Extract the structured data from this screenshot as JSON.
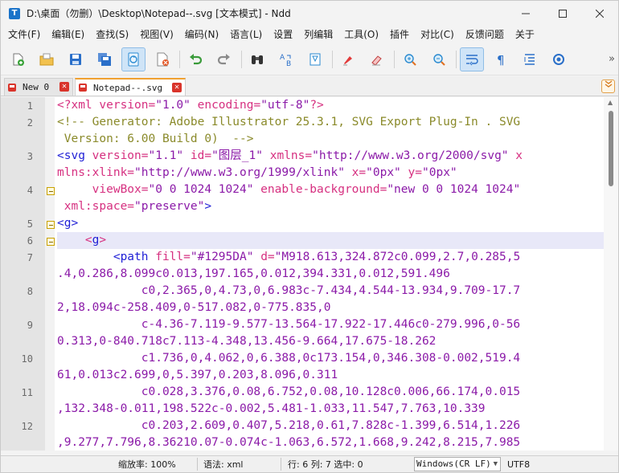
{
  "window": {
    "title": "D:\\桌面（勿删）\\Desktop\\Notepad--.svg [文本模式] - Ndd",
    "app_icon_letter": "T"
  },
  "menu": [
    "文件(F)",
    "编辑(E)",
    "查找(S)",
    "视图(V)",
    "编码(N)",
    "语言(L)",
    "设置",
    "列编辑",
    "工具(O)",
    "插件",
    "对比(C)",
    "反馈问题",
    "关于"
  ],
  "toolbar": {
    "buttons": [
      "new-file-icon",
      "open-folder-icon",
      "save-icon",
      "save-all-icon",
      "file-sync-icon",
      "close-file-icon",
      "undo-icon",
      "redo-icon",
      "find-binoculars-icon",
      "replace-icon",
      "bookmark-icon",
      "highlight-marker-icon",
      "eraser-icon",
      "zoom-in-icon",
      "zoom-out-icon",
      "word-wrap-icon",
      "show-symbols-icon",
      "indent-guide-icon",
      "settings-circle-icon"
    ],
    "more_label": "»"
  },
  "tabs": [
    {
      "label": "New 0",
      "active": false
    },
    {
      "label": "Notepad--.svg",
      "active": true
    }
  ],
  "editor": {
    "lines": [
      {
        "num": "1",
        "fold": false,
        "rows": 1
      },
      {
        "num": "2",
        "fold": false,
        "rows": 2
      },
      {
        "num": "3",
        "fold": false,
        "rows": 2
      },
      {
        "num": "4",
        "fold": true,
        "rows": 2
      },
      {
        "num": "5",
        "fold": true,
        "rows": 1
      },
      {
        "num": "6",
        "fold": true,
        "rows": 1
      },
      {
        "num": "7",
        "fold": false,
        "rows": 2
      },
      {
        "num": "8",
        "fold": false,
        "rows": 2
      },
      {
        "num": "9",
        "fold": false,
        "rows": 2
      },
      {
        "num": "10",
        "fold": false,
        "rows": 2
      },
      {
        "num": "11",
        "fold": false,
        "rows": 2
      },
      {
        "num": "12",
        "fold": false,
        "rows": 2
      }
    ],
    "highlighted_line": "6",
    "code": {
      "l1_pi_open": "<?xml ",
      "l1_a1": "version=",
      "l1_v1": "\"1.0\"",
      "l1_a2": " encoding=",
      "l1_v2": "\"utf-8\"",
      "l1_pi_close": "?>",
      "l2_r1": "<!-- Generator: Adobe Illustrator 25.3.1, SVG Export Plug-In . SVG",
      "l2_r2": " Version: 6.00 Build 0)  -->",
      "l3_tag": "<svg",
      "l3_a1": " version=",
      "l3_v1": "\"1.1\"",
      "l3_a2": " id=",
      "l3_v2": "\"图层_1\"",
      "l3_a3": " xmlns=",
      "l3_v3": "\"http://www.w3.org/2000/svg\"",
      "l3_a4": " x",
      "l3_r2_a1": "mlns:xlink=",
      "l3_r2_v1": "\"http://www.w3.org/1999/xlink\"",
      "l3_r2_a2": " x=",
      "l3_r2_v2": "\"0px\"",
      "l3_r2_a3": " y=",
      "l3_r2_v3": "\"0px\"",
      "l4_indent": "     ",
      "l4_a1": "viewBox=",
      "l4_v1": "\"0 0 1024 1024\"",
      "l4_a2": " enable-background=",
      "l4_v2": "\"new 0 0 1024 1024\"",
      "l4_r2_a1": " xml:space=",
      "l4_r2_v1": "\"preserve\"",
      "l4_r2_close": ">",
      "l5_tag": "<g>",
      "l6_indent": "    ",
      "l6_lt": "<",
      "l6_g": "g",
      "l6_gt": ">",
      "l7_indent": "        ",
      "l7_tag": "<path",
      "l7_a1": " fill=",
      "l7_v1": "\"#1295DA\"",
      "l7_a2": " d=",
      "l7_v2": "\"M918.613,324.872c0.099,2.7,0.285,5",
      "l7_r2": ".4,0.286,8.099c0.013,197.165,0.012,394.331,0.012,591.496",
      "l8_r1": "            c0,2.365,0,4.73,0,6.983c-7.434,4.544-13.934,9.709-17.7",
      "l8_r2": "2,18.094c-258.409,0-517.082,0-775.835,0",
      "l9_r1": "            c-4.36-7.119-9.577-13.564-17.922-17.446c0-279.996,0-56",
      "l9_r2": "0.313,0-840.718c7.113-4.348,13.456-9.664,17.675-18.262",
      "l10_r1": "            c1.736,0,4.062,0,6.388,0c173.154,0,346.308-0.002,519.4",
      "l10_r2": "61,0.013c2.699,0,5.397,0.203,8.096,0.311",
      "l11_r1": "            c0.028,3.376,0.08,6.752,0.08,10.128c0.006,66.174,0.015",
      "l11_r2": ",132.348-0.011,198.522c-0.002,5.481-1.033,11.547,7.763,10.339",
      "l12_r1": "            c0.203,2.609,0.407,5.218,0.61,7.828c-1.399,6.514,1.226",
      "l12_r2": ",9.277,7.796,8.36210.07-0.074c-1.063,6.572,1.668,9.242,8.215,7.985"
    }
  },
  "status": {
    "zoom": "缩放率: 100%",
    "syntax": "语法: xml",
    "position": "行: 6 列: 7 选中: 0",
    "line_ending": "Windows(CR LF)",
    "encoding": "UTF8"
  },
  "colors": {
    "accent_tab": "#f0a030",
    "path_fill_value": "#1295DA"
  }
}
